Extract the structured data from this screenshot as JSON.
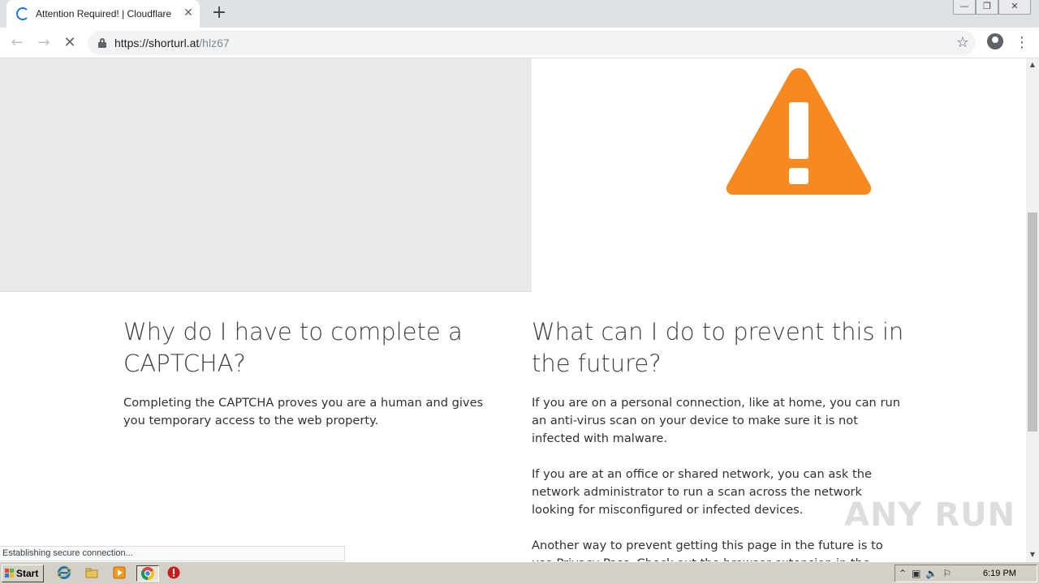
{
  "browser": {
    "tab": {
      "title": "Attention Required! | Cloudflare",
      "close": "✕"
    },
    "new_tab": "+",
    "window_controls": {
      "minimize": "—",
      "restore": "❐",
      "close": "✕"
    },
    "nav": {
      "back": "←",
      "forward": "→",
      "stop": "✕"
    },
    "address": {
      "host": "https://shorturl.at",
      "path": "/hlz67"
    },
    "bookmark": "☆",
    "menu": "⋮",
    "status": "Establishing secure connection..."
  },
  "page": {
    "colors": {
      "warning": "#f6891f",
      "grey_panel": "#e9e9e9",
      "link": "#2f7bbf"
    },
    "left": {
      "heading": "Why do I have to complete a CAPTCHA?",
      "body": "Completing the CAPTCHA proves you are a human and gives you temporary access to the web property."
    },
    "right": {
      "heading": "What can I do to prevent this in the future?",
      "p1": "If you are on a personal connection, like at home, you can run an anti-virus scan on your device to make sure it is not infected with malware.",
      "p2": "If you are at an office or shared network, you can ask the network administrator to run a scan across the network looking for misconfigured or infected devices.",
      "p3": "Another way to prevent getting this page in the future is to use Privacy Pass. Check out the browser extension in the Chrome"
    },
    "watermark": "ANY RUN"
  },
  "taskbar": {
    "start_label": "Start",
    "clock": "6:19 PM",
    "tray_icons": [
      "up-arrow-icon",
      "network-icon",
      "volume-icon",
      "flag-icon"
    ]
  }
}
